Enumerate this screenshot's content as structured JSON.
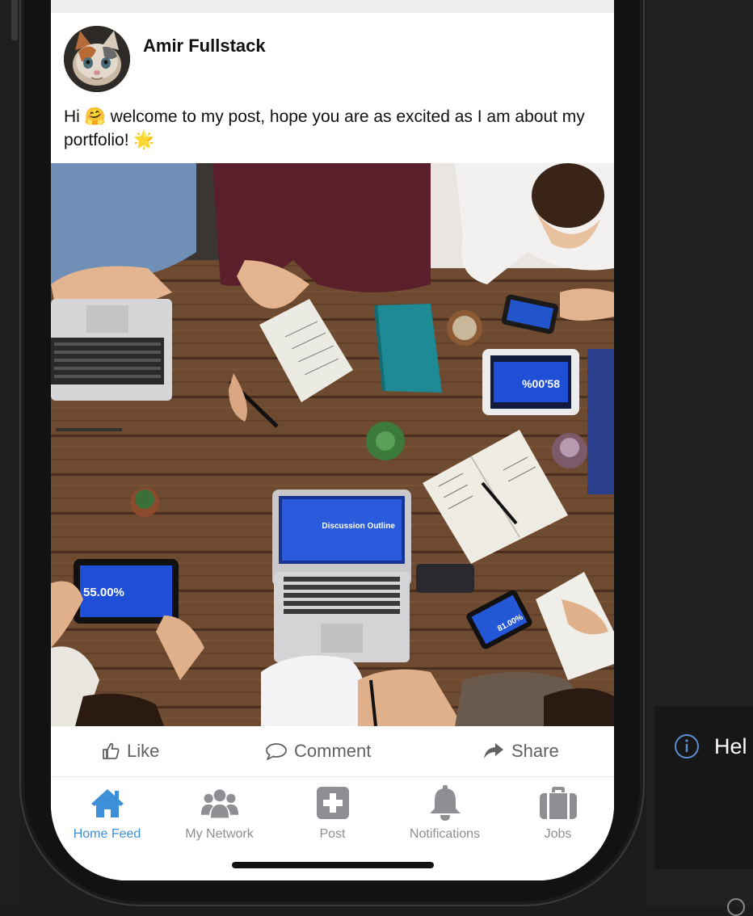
{
  "post": {
    "author": "Amir Fullstack",
    "text_before_emoji": "Hi ",
    "hug_emoji": "🤗",
    "text_middle": " welcome to my post, hope you are as excited as I am about my portfolio! ",
    "star_emoji": "🌟",
    "image_laptop_text": "Discussion Outline",
    "image_tablet_left_text": "55.00%",
    "image_tablet_right_text": "%00'58",
    "image_phone_text": "81.00%"
  },
  "actions": {
    "like": "Like",
    "comment": "Comment",
    "share": "Share"
  },
  "tabs": [
    {
      "label": "Home Feed",
      "icon": "home-icon",
      "active": true
    },
    {
      "label": "My Network",
      "icon": "people-icon",
      "active": false
    },
    {
      "label": "Post",
      "icon": "plus-square-icon",
      "active": false
    },
    {
      "label": "Notifications",
      "icon": "bell-icon",
      "active": false
    },
    {
      "label": "Jobs",
      "icon": "briefcase-icon",
      "active": false
    }
  ],
  "toast": {
    "text": "Hel",
    "icon": "info-icon"
  },
  "colors": {
    "accent": "#3d8fd8",
    "inactive": "#8e8e93",
    "action_text": "#616161",
    "background": "#1c1c1e"
  }
}
